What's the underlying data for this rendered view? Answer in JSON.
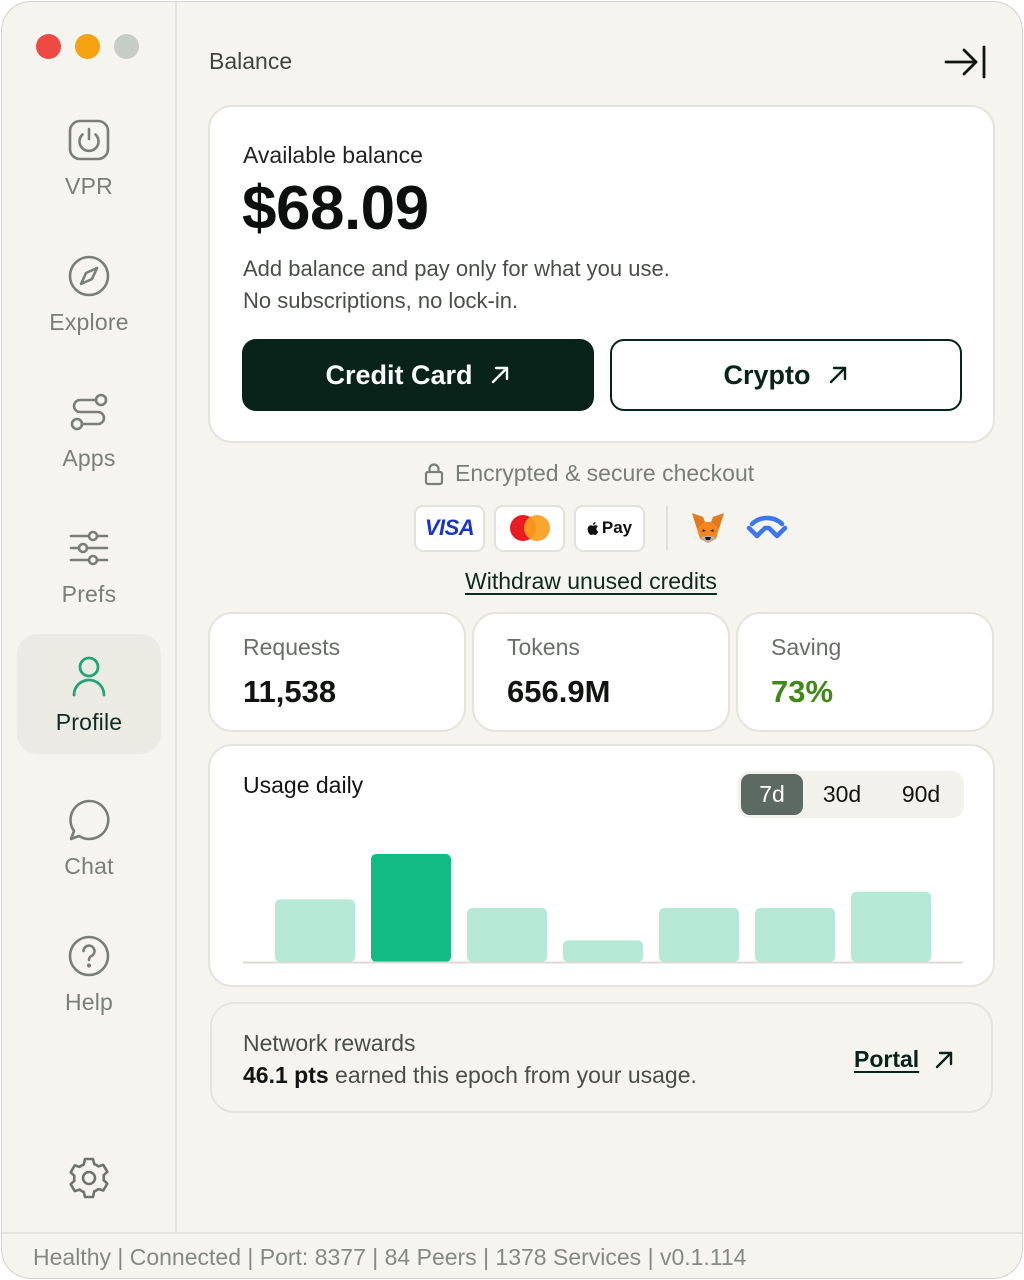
{
  "window": {
    "controls": [
      "close",
      "minimize",
      "zoom"
    ]
  },
  "sidebar": {
    "items": [
      {
        "label": "VPR",
        "icon": "power-icon"
      },
      {
        "label": "Explore",
        "icon": "compass-icon"
      },
      {
        "label": "Apps",
        "icon": "route-icon"
      },
      {
        "label": "Prefs",
        "icon": "sliders-icon"
      },
      {
        "label": "Profile",
        "icon": "user-icon",
        "active": true
      },
      {
        "label": "Chat",
        "icon": "chat-bubble-icon"
      },
      {
        "label": "Help",
        "icon": "help-circle-icon"
      }
    ],
    "settings_icon": "gear-icon"
  },
  "header": {
    "title": "Balance",
    "collapse_icon": "collapse-right-icon"
  },
  "balance": {
    "label": "Available balance",
    "amount": "$68.09",
    "description_line1": "Add balance and pay only for what you use.",
    "description_line2": "No subscriptions, no lock-in.",
    "credit_card_label": "Credit Card",
    "crypto_label": "Crypto"
  },
  "checkout": {
    "secure_text": "Encrypted & secure checkout",
    "methods": [
      "VISA",
      "Mastercard",
      "Pay",
      "MetaMask",
      "WalletConnect"
    ],
    "visa_label": "VISA",
    "applepay_label": "Pay",
    "withdraw_label": "Withdraw unused credits"
  },
  "stats": [
    {
      "label": "Requests",
      "value": "11,538"
    },
    {
      "label": "Tokens",
      "value": "656.9M"
    },
    {
      "label": "Saving",
      "value": "73%"
    }
  ],
  "usage": {
    "title": "Usage daily",
    "ranges": [
      "7d",
      "30d",
      "90d"
    ],
    "selected_range": "7d"
  },
  "chart_data": {
    "type": "bar",
    "title": "Usage daily",
    "categories": [
      "",
      "",
      "",
      "",
      "",
      "",
      ""
    ],
    "values": [
      0.58,
      1.0,
      0.5,
      0.2,
      0.5,
      0.5,
      0.65
    ],
    "highlighted_index": 1,
    "colors": {
      "default": "#b5e9d5",
      "highlight": "#13bb84"
    },
    "ylim": [
      0,
      1
    ],
    "grid": false
  },
  "rewards": {
    "title": "Network rewards",
    "points": "46.1 pts",
    "text": " earned this epoch from your usage.",
    "portal_label": "Portal"
  },
  "status": {
    "text": "Healthy | Connected | Port: 8377 | 84 Peers | 1378 Services | v0.1.114"
  },
  "colors": {
    "background": "#f6f4ee",
    "primary": "#07231a",
    "accent_green": "#13bb84",
    "saving_green": "#3f8a16"
  }
}
